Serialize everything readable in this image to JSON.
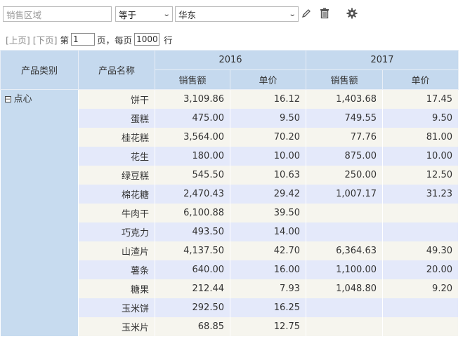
{
  "filter": {
    "field_placeholder": "销售区域",
    "operator": "等于",
    "value": "华东"
  },
  "pager": {
    "prev": "[上页]",
    "next": "[下页]",
    "page_prefix": "第",
    "page_value": "1",
    "page_suffix": "页，每页",
    "rows_value": "1000",
    "rows_suffix": "行"
  },
  "table": {
    "col_category": "产品类别",
    "col_name": "产品名称",
    "years": [
      "2016",
      "2017"
    ],
    "sub_sales": "销售额",
    "sub_price": "单价",
    "category": "点心",
    "rows": [
      {
        "name": "饼干",
        "s2016": "3,109.86",
        "p2016": "16.12",
        "s2017": "1,403.68",
        "p2017": "17.45"
      },
      {
        "name": "蛋糕",
        "s2016": "475.00",
        "p2016": "9.50",
        "s2017": "749.55",
        "p2017": "9.50"
      },
      {
        "name": "桂花糕",
        "s2016": "3,564.00",
        "p2016": "70.20",
        "s2017": "77.76",
        "p2017": "81.00"
      },
      {
        "name": "花生",
        "s2016": "180.00",
        "p2016": "10.00",
        "s2017": "875.00",
        "p2017": "10.00"
      },
      {
        "name": "绿豆糕",
        "s2016": "545.50",
        "p2016": "10.63",
        "s2017": "250.00",
        "p2017": "12.50"
      },
      {
        "name": "棉花糖",
        "s2016": "2,470.43",
        "p2016": "29.42",
        "s2017": "1,007.17",
        "p2017": "31.23"
      },
      {
        "name": "牛肉干",
        "s2016": "6,100.88",
        "p2016": "39.50",
        "s2017": "",
        "p2017": ""
      },
      {
        "name": "巧克力",
        "s2016": "493.50",
        "p2016": "14.00",
        "s2017": "",
        "p2017": ""
      },
      {
        "name": "山渣片",
        "s2016": "4,137.50",
        "p2016": "42.70",
        "s2017": "6,364.63",
        "p2017": "49.30"
      },
      {
        "name": "薯条",
        "s2016": "640.00",
        "p2016": "16.00",
        "s2017": "1,100.00",
        "p2017": "20.00"
      },
      {
        "name": "糖果",
        "s2016": "212.44",
        "p2016": "7.93",
        "s2017": "1,048.80",
        "p2017": "9.20"
      },
      {
        "name": "玉米饼",
        "s2016": "292.50",
        "p2016": "16.25",
        "s2017": "",
        "p2017": ""
      },
      {
        "name": "玉米片",
        "s2016": "68.85",
        "p2016": "12.75",
        "s2017": "",
        "p2017": ""
      }
    ]
  },
  "icons": {
    "edit": "pencil-icon",
    "delete": "trash-icon",
    "settings": "gear-icon",
    "collapse": "minus-box-icon"
  },
  "colors": {
    "header_bg": "#c5d9ee",
    "row_odd": "#f6f5ee",
    "row_even": "#e4e9fa"
  }
}
